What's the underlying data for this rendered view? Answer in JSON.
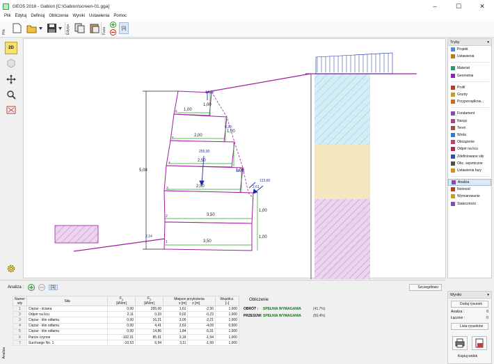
{
  "window": {
    "title": "GEO5 2016 - Gabion [C:\\Gabion\\screen-01.gga]",
    "minimize": "–",
    "maximize": "☐",
    "close": "✕"
  },
  "menu": [
    "Plik",
    "Edytuj",
    "Definiuj",
    "Obliczenia",
    "Wyniki",
    "Ustawienia",
    "Pomoc"
  ],
  "toolbar": {
    "group_file": "Plik",
    "group_edit": "Edycja",
    "group_phase": "Faza",
    "phase_number": "[1]"
  },
  "left_tools": {
    "view_2d": "2D"
  },
  "drawing": {
    "height_dim": "5,08",
    "load_top": "14,00",
    "block_widths": [
      "1,00",
      "2,00",
      "2,50",
      "2,50",
      "3,50",
      "3,50"
    ],
    "block_heights": [
      "1,00",
      "1,00",
      "1,00",
      "1,00",
      "1,00"
    ],
    "block_numbers": [
      "6",
      "5",
      "4",
      "3",
      "2",
      "1"
    ],
    "force_weight": "255,00",
    "force_a": "16,21",
    "force_b": "123,60",
    "force_c": "2,61",
    "small_dim_a": "0,20",
    "small_dim_b": "2,14"
  },
  "right_panel": {
    "header": "Tryby",
    "pin": "▾",
    "items": [
      {
        "label": "Projekt",
        "icon": "project-icon",
        "color": "#4a8fd4"
      },
      {
        "label": "Ustawienia",
        "icon": "settings-icon",
        "color": "#c07a10"
      },
      {
        "gap": true
      },
      {
        "label": "Materiał",
        "icon": "material-icon",
        "color": "#2a9a6a"
      },
      {
        "label": "Geometria",
        "icon": "geometry-icon",
        "color": "#8b2ab0"
      },
      {
        "gap": true
      },
      {
        "label": "Profil",
        "icon": "profile-icon",
        "color": "#b04020"
      },
      {
        "label": "Grunty",
        "icon": "soils-icon",
        "color": "#c0a020"
      },
      {
        "label": "Przyporządkow...",
        "icon": "assign-icon",
        "color": "#c07020"
      },
      {
        "gap": true
      },
      {
        "label": "Fundament",
        "icon": "foundation-icon",
        "color": "#8a4ab0"
      },
      {
        "label": "Nasyp",
        "icon": "backfill-icon",
        "color": "#b04080"
      },
      {
        "label": "Teren",
        "icon": "terrain-icon",
        "color": "#a05030"
      },
      {
        "label": "Woda",
        "icon": "water-icon",
        "color": "#3080d0"
      },
      {
        "label": "Obciążenie",
        "icon": "surcharge-icon",
        "color": "#c04070"
      },
      {
        "label": "Odpór na licu",
        "icon": "front-resistance-icon",
        "color": "#a03050"
      },
      {
        "label": "Zdefiniowane siły",
        "icon": "applied-forces-icon",
        "color": "#3050b0"
      },
      {
        "label": "Obc. sejsmiczne",
        "icon": "earthquake-icon",
        "color": "#505050"
      },
      {
        "label": "Ustawienia fazy",
        "icon": "stage-settings-icon",
        "color": "#d09020"
      },
      {
        "gap": true
      },
      {
        "label": "Analiza",
        "icon": "analysis-icon",
        "color": "#8a4ab0",
        "active": true
      },
      {
        "label": "Nośność",
        "icon": "bearing-icon",
        "color": "#b04020"
      },
      {
        "label": "Wymiarowanie",
        "icon": "dimensioning-icon",
        "color": "#c0a020"
      },
      {
        "label": "Stateczność",
        "icon": "stability-icon",
        "color": "#8a4ab0"
      }
    ]
  },
  "analysis": {
    "label": "Analiza :",
    "phase_btn": "[1]",
    "detail_btn": "Szczegółowo",
    "side_label": "Analiza",
    "columns": {
      "num": "Numer",
      "num2": "siły",
      "force": "Siła",
      "fx": "F",
      "fx_sub": "x",
      "fx_unit": "[kN/m]",
      "fz": "F",
      "fz_sub": "z",
      "fz_unit": "[kN/m]",
      "app": "Miejsce przyłożenia",
      "x_unit": "x [m]",
      "z_unit": "z [m]",
      "coef": "Współcz.",
      "coef_unit": "[–]"
    },
    "rows": [
      {
        "n": "1",
        "name": "Ciężar - ściana",
        "fx": "0,00",
        "fz": "255,00",
        "x": "1,61",
        "z": "-2,30",
        "c": "1,000"
      },
      {
        "n": "2",
        "name": "Odpór na licu",
        "fx": "2,11",
        "fz": "0,33",
        "x": "0,02",
        "z": "-0,23",
        "c": "1,000"
      },
      {
        "n": "3",
        "name": "Ciężar - klin odłamu",
        "fx": "0,00",
        "fz": "16,21",
        "x": "3,05",
        "z": "-2,21",
        "c": "1,000"
      },
      {
        "n": "4",
        "name": "Ciężar - klin odłamu",
        "fx": "0,00",
        "fz": "4,41",
        "x": "2,63",
        "z": "-4,09",
        "c": "0,500"
      },
      {
        "n": "5",
        "name": "Ciężar - klin odłamu",
        "fx": "0,00",
        "fz": "14,86",
        "x": "1,84",
        "z": "-5,31",
        "c": "1,000"
      },
      {
        "n": "6",
        "name": "Parcie czynne",
        "fx": "-102,31",
        "fz": "85,91",
        "x": "3,18",
        "z": "-1,94",
        "c": "1,000"
      },
      {
        "n": "7",
        "name": "Surcharge No. 1",
        "fx": "-10,53",
        "fz": "6,94",
        "x": "3,11",
        "z": "-1,99",
        "c": "1,000"
      }
    ],
    "calc": {
      "title": "Obliczenie",
      "r1_key": "OBRÓT :",
      "r1_val": "SPEŁNIA WYMAGANIA",
      "r1_pct": "(41,7%)",
      "r2_key": "PRZESUW:",
      "r2_val": "SPEŁNIA WYMAGANIA",
      "r2_pct": "(50,4%)"
    }
  },
  "outputs": {
    "header": "Wyniki",
    "pin": "▾",
    "add_btn": "Dodaj rysunek",
    "line1_label": "Analiza :",
    "line1_val": "0",
    "line2_label": "Łącznie :",
    "line2_val": "0",
    "list_btn": "Lista rysunków",
    "copy_btn": "Kopiuj widok"
  }
}
